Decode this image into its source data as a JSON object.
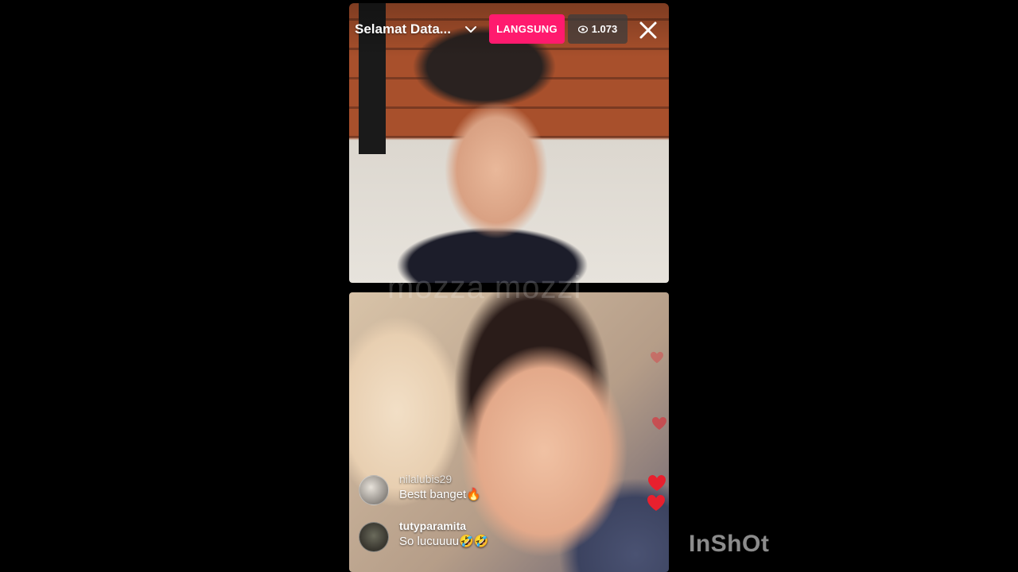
{
  "header": {
    "host_name": "Selamat Data...",
    "live_label": "LANGSUNG",
    "viewer_count": "1.073"
  },
  "stream": {
    "overlay_watermark": "mozza mozzi"
  },
  "comments": [
    {
      "username": "nilalubis29",
      "message": "Bestt banget🔥"
    },
    {
      "username": "tutyparamita",
      "message": "So lucuuuu🤣🤣"
    }
  ],
  "app_watermark": "InShOt",
  "colors": {
    "live_badge": "#ff1a6e",
    "viewer_badge": "#3c3c3c",
    "heart": "#e8202e"
  },
  "icons": {
    "chevron": "chevron-down-icon",
    "eye": "eye-icon",
    "close": "close-icon",
    "heart": "heart-icon"
  }
}
